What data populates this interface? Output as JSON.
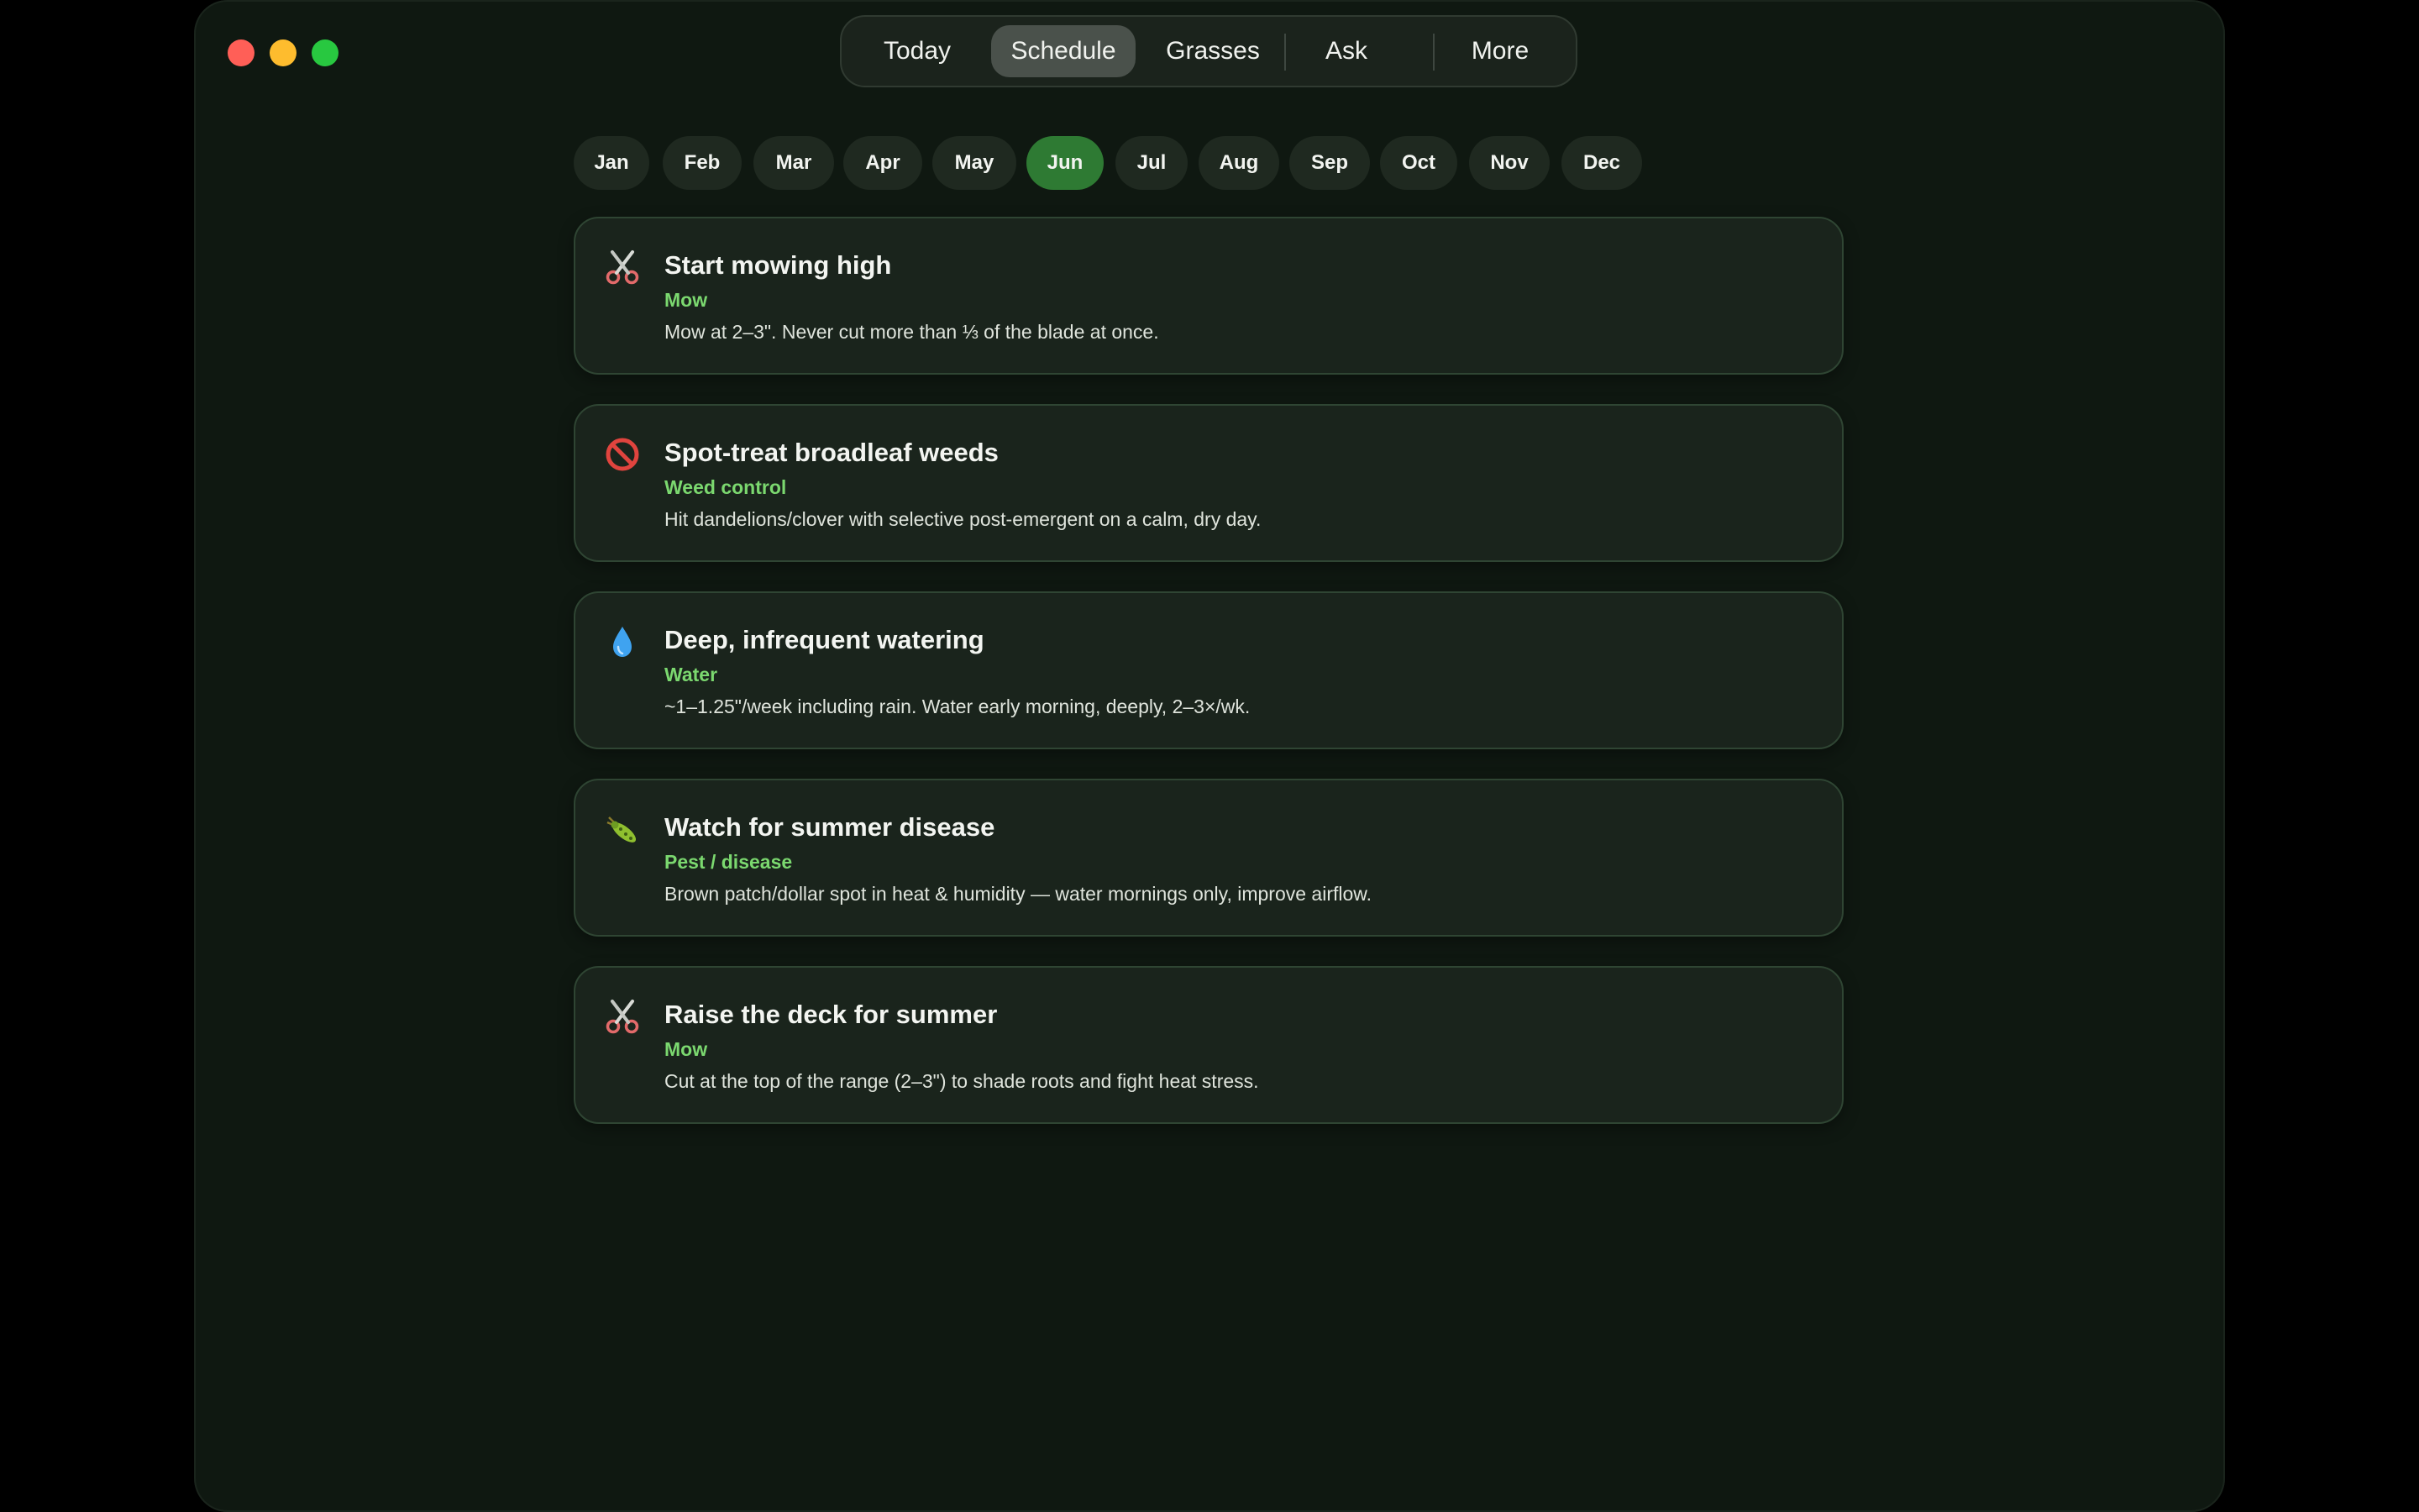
{
  "window": {
    "controls": [
      "close",
      "minimize",
      "zoom"
    ]
  },
  "nav": {
    "tabs": [
      {
        "label": "Today"
      },
      {
        "label": "Schedule"
      },
      {
        "label": "Grasses"
      },
      {
        "label": "Ask"
      },
      {
        "label": "More"
      }
    ],
    "active": "Schedule"
  },
  "months": {
    "items": [
      "Jan",
      "Feb",
      "Mar",
      "Apr",
      "May",
      "Jun",
      "Jul",
      "Aug",
      "Sep",
      "Oct",
      "Nov",
      "Dec"
    ],
    "selected": "Jun"
  },
  "tasks": [
    {
      "icon": "scissors-icon",
      "title": "Start mowing high",
      "category": "Mow",
      "description": "Mow at 2–3\". Never cut more than ⅓ of the blade at once."
    },
    {
      "icon": "prohibited-icon",
      "title": "Spot-treat broadleaf weeds",
      "category": "Weed control",
      "description": "Hit dandelions/clover with selective post-emergent on a calm, dry day."
    },
    {
      "icon": "droplet-icon",
      "title": "Deep, infrequent watering",
      "category": "Water",
      "description": "~1–1.25\"/week including rain. Water early morning, deeply, 2–3×/wk."
    },
    {
      "icon": "bug-icon",
      "title": "Watch for summer disease",
      "category": "Pest / disease",
      "description": "Brown patch/dollar spot in heat & humidity — water mornings only, improve airflow."
    },
    {
      "icon": "scissors-icon",
      "title": "Raise the deck for summer",
      "category": "Mow",
      "description": "Cut at the top of the range (2–3\") to shade roots and fight heat stress."
    }
  ],
  "colors": {
    "accent": "#2e7a33",
    "category_text": "#7bd86f",
    "background": "#0f1811",
    "card": "#1a241c"
  }
}
